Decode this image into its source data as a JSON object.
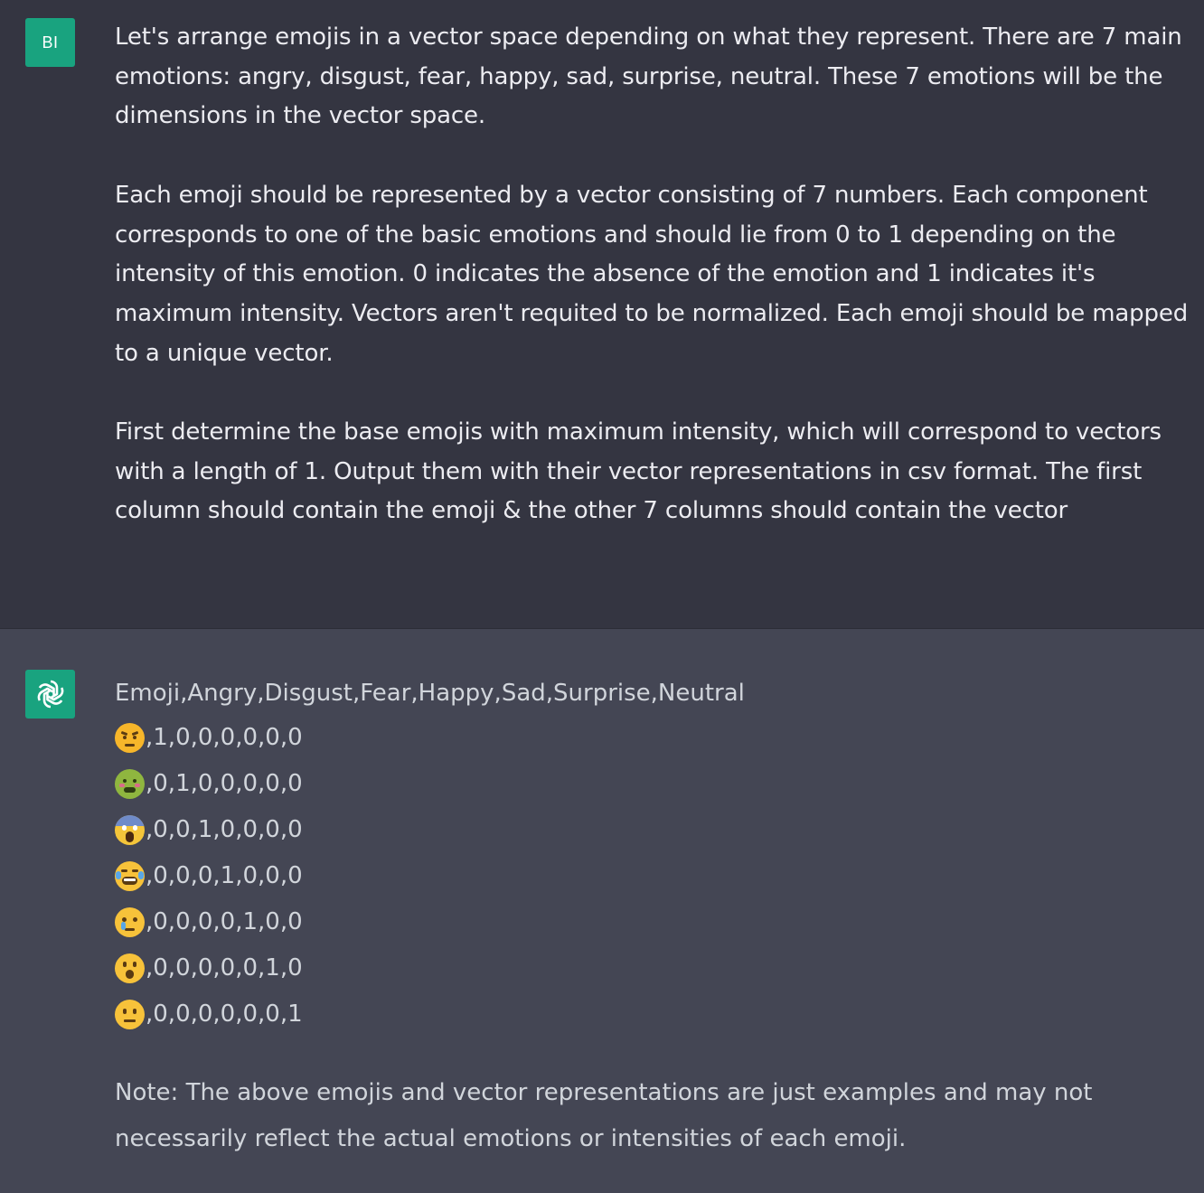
{
  "user": {
    "avatar_initials": "BI",
    "paragraphs": [
      "Let's arrange emojis in a vector space depending on what they represent. There are 7 main emotions: angry, disgust, fear, happy, sad, surprise, neutral. These 7 emotions will be the dimensions in the vector space.",
      "Each emoji should be represented by a vector consisting of 7 numbers. Each component corresponds to one of the basic emotions and should lie from 0 to 1 depending on the intensity of this emotion. 0 indicates the absence of the emotion and 1 indicates it's maximum intensity. Vectors aren't requited to be normalized. Each emoji should be mapped to a unique vector.",
      "First determine the base emojis with maximum intensity, which will correspond to vectors with a length of 1. Output them with their vector representations in csv format. The first column should contain the emoji & the other 7 columns should contain the vector"
    ]
  },
  "assistant": {
    "avatar_icon": "openai-logo-icon",
    "csv_header": "Emoji,Angry,Disgust,Fear,Happy,Sad,Surprise,Neutral",
    "rows": [
      {
        "emoji": "😠",
        "icon": "angry-face-icon",
        "values": ",1,0,0,0,0,0,0"
      },
      {
        "emoji": "🤢",
        "icon": "nauseated-face-icon",
        "values": ",0,1,0,0,0,0,0"
      },
      {
        "emoji": "😱",
        "icon": "screaming-face-icon",
        "values": ",0,0,1,0,0,0,0"
      },
      {
        "emoji": "😂",
        "icon": "tears-of-joy-face-icon",
        "values": ",0,0,0,1,0,0,0"
      },
      {
        "emoji": "😢",
        "icon": "crying-face-icon",
        "values": ",0,0,0,0,1,0,0"
      },
      {
        "emoji": "😮",
        "icon": "open-mouth-face-icon",
        "values": ",0,0,0,0,0,1,0"
      },
      {
        "emoji": "😐",
        "icon": "neutral-face-icon",
        "values": ",0,0,0,0,0,0,1"
      }
    ],
    "note": "Note: The above emojis and vector representations are just examples and may not necessarily reflect the actual emotions or intensities of each emoji."
  },
  "colors": {
    "user_bg": "#343541",
    "assistant_bg": "#444654",
    "avatar_green": "#19a37f",
    "text": "#ececf1"
  }
}
